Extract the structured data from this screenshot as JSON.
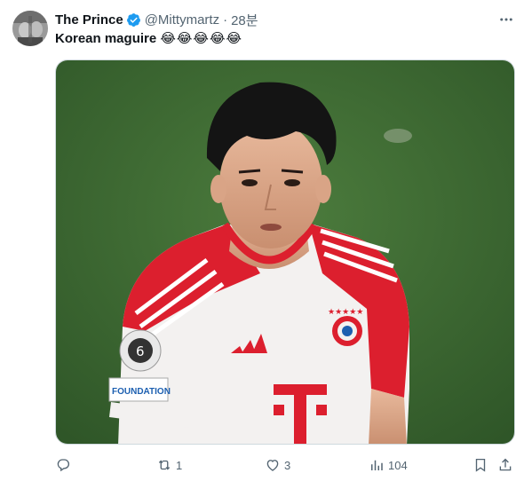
{
  "author": {
    "name": "The Prince",
    "handle": "@Mittymartz",
    "separator": "·",
    "time": "28분",
    "verified": true
  },
  "tweet": {
    "text": "Korean maguire",
    "emojis": "😂😂😂😂😂"
  },
  "media": {
    "kit_badge_text": "FOUNDATION",
    "ucl_badge_number": "6"
  },
  "actions": {
    "reply_count": "",
    "retweet_count": "1",
    "like_count": "3",
    "views_count": "104"
  },
  "icons": {
    "verified": "verified-badge-icon",
    "more": "more-horizontal-icon",
    "reply": "reply-icon",
    "retweet": "retweet-icon",
    "like": "heart-icon",
    "views": "views-chart-icon",
    "bookmark": "bookmark-icon",
    "share": "share-icon"
  },
  "colors": {
    "accent": "#1d9bf0",
    "text": "#0f1419",
    "secondary": "#536471",
    "pitch": "#3f6b33",
    "jersey_red": "#dc1f2e"
  }
}
